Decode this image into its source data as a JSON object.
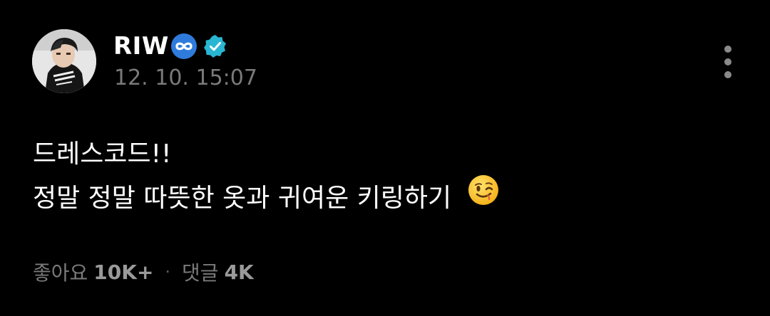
{
  "colors": {
    "background": "#000000",
    "text_primary": "#ffffff",
    "text_secondary": "#7a7a7a",
    "verified_badge": "#29b6d2",
    "infinity_badge": "#2f7bdc"
  },
  "author": {
    "name": "RIW",
    "badge_icon": "infinity-icon",
    "verified_icon": "verified-check-icon",
    "avatar_icon": "profile-photo"
  },
  "post": {
    "timestamp": "12. 10. 15:07",
    "lines": [
      "드레스코드!!",
      "정말 정말 따뜻한 옷과 귀여운 키링하기"
    ],
    "emoji": "winking-face-icon"
  },
  "stats": {
    "likes_label": "좋아요",
    "likes_value": "10K+",
    "separator": "·",
    "comments_label": "댓글",
    "comments_value": "4K"
  },
  "menu": {
    "icon": "more-vertical-icon"
  }
}
